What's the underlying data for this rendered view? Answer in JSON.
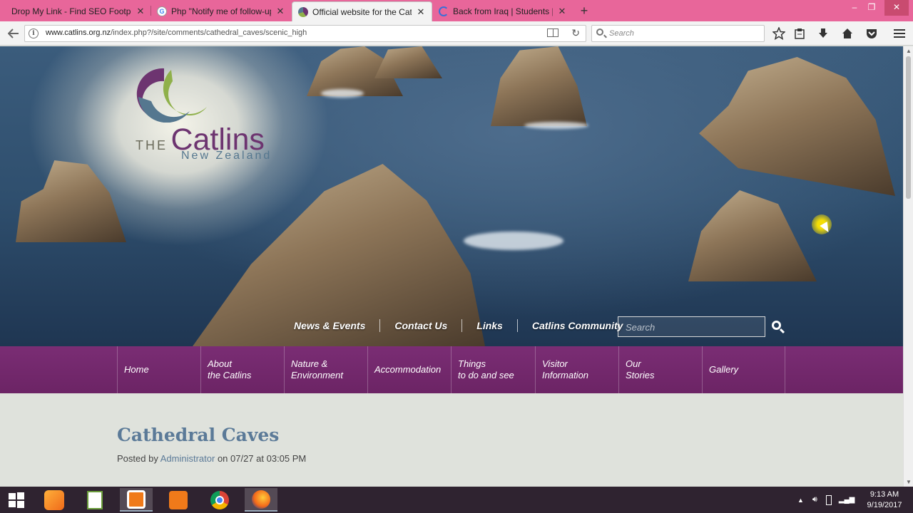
{
  "browser": {
    "tabs": [
      {
        "title": "Drop My Link - Find SEO Footpr",
        "favicon": "page-icon",
        "active": false
      },
      {
        "title": "Php \"Notify me of follow-up",
        "favicon": "google-icon",
        "active": false
      },
      {
        "title": "Official website for the Catli",
        "favicon": "catlins-icon",
        "active": true
      },
      {
        "title": "Back from Iraq | Students | B",
        "favicon": "loading-icon",
        "active": false
      }
    ],
    "new_tab": "+",
    "window_controls": {
      "minimize": "–",
      "restore": "❐",
      "close": "✕"
    },
    "url_host": "www.catlins.org.nz",
    "url_path": "/index.php?/site/comments/cathedral_caves/scenic_high",
    "search_placeholder": "Search"
  },
  "site": {
    "logo": {
      "the": "THE",
      "name": "Catlins",
      "country": "New Zealand"
    },
    "top_links": [
      "News & Events",
      "Contact Us",
      "Links",
      "Catlins Community"
    ],
    "search_placeholder": "Search",
    "main_nav": [
      "Home",
      "About\nthe Catlins",
      "Nature &\nEnvironment",
      "Accommodation",
      "Things\nto do and see",
      "Visitor\nInformation",
      "Our\nStories",
      "Gallery"
    ],
    "article": {
      "title": "Cathedral Caves",
      "posted_by_label": "Posted by",
      "author": "Administrator",
      "date_text": "on 07/27 at 03:05 PM"
    }
  },
  "taskbar": {
    "apps": [
      "start-icon",
      "uc-browser-icon",
      "notepad-icon",
      "screen-recorder-icon",
      "camera-icon",
      "chrome-icon",
      "firefox-icon"
    ],
    "time": "9:13 AM",
    "date": "9/19/2017"
  },
  "colors": {
    "tab_strip": "#e8669a",
    "main_nav": "#6c2465",
    "title": "#5b7a98"
  }
}
